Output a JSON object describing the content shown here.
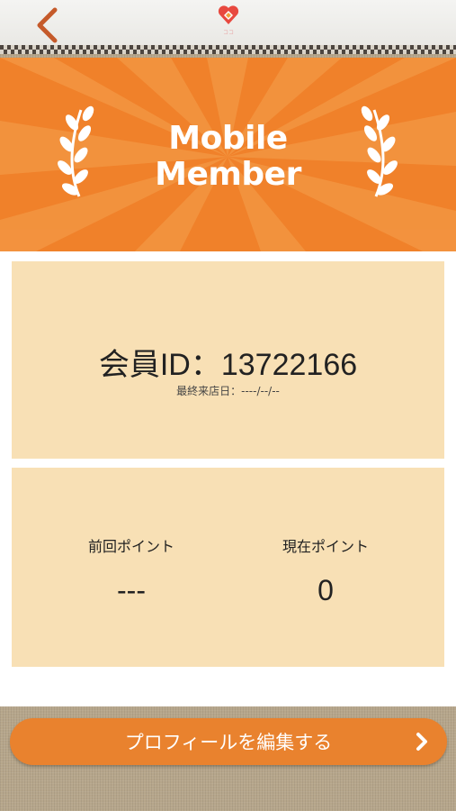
{
  "header": {
    "back_icon": "chevron-left-icon",
    "logo_icon": "heart-logo-icon",
    "logo_text": "ココ"
  },
  "banner": {
    "title_line1": "Mobile",
    "title_line2": "Member",
    "color": "#f0812a"
  },
  "member": {
    "id_label": "会員ID：",
    "id_value": "13722166",
    "last_visit_label": "最終来店日：",
    "last_visit_value": "----/--/--"
  },
  "points": {
    "previous_label": "前回ポイント",
    "previous_value": "---",
    "current_label": "現在ポイント",
    "current_value": "0"
  },
  "actions": {
    "edit_profile_label": "プロフィールを編集する",
    "edit_profile_icon": "chevron-right-icon"
  },
  "colors": {
    "accent": "#e9822e",
    "card": "#f8e0b5"
  }
}
